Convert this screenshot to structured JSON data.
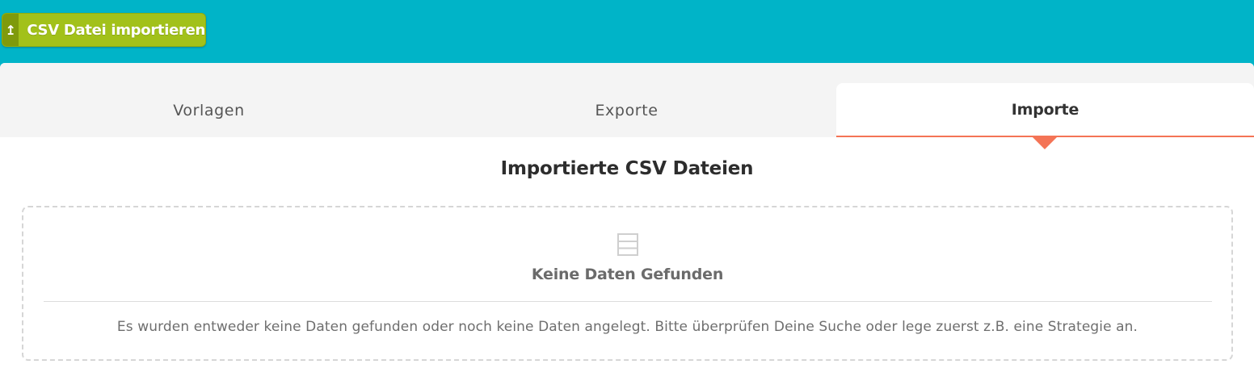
{
  "header": {
    "import_button": {
      "icon": "upload-arrow-icon",
      "label": "CSV Datei importieren"
    }
  },
  "tabs": [
    {
      "label": "Vorlagen",
      "active": false
    },
    {
      "label": "Exporte",
      "active": false
    },
    {
      "label": "Importe",
      "active": true
    }
  ],
  "content": {
    "title": "Importierte CSV Dateien",
    "empty_state": {
      "icon": "table-icon",
      "title": "Keine Daten Gefunden",
      "message": "Es wurden entweder keine Daten gefunden oder noch keine Daten angelegt. Bitte überprüfen Deine Suche oder lege zuerst z.B. eine Strategie an."
    }
  },
  "colors": {
    "header_bg": "#00b4c8",
    "button_bg": "#a2c11a",
    "button_icon_bg": "#7f9a0c",
    "active_tab_accent": "#f47456"
  }
}
